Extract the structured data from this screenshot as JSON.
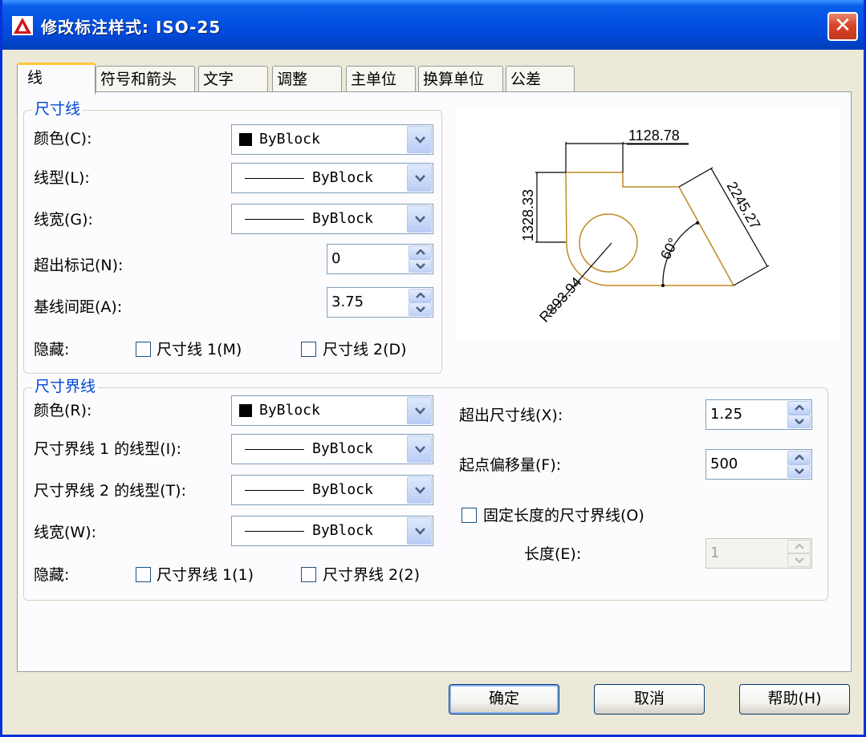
{
  "window": {
    "title": "修改标注样式: ISO-25",
    "close_label": "✕"
  },
  "tabs": [
    {
      "label": "线",
      "active": true
    },
    {
      "label": "符号和箭头"
    },
    {
      "label": "文字"
    },
    {
      "label": "调整"
    },
    {
      "label": "主单位"
    },
    {
      "label": "换算单位"
    },
    {
      "label": "公差"
    }
  ],
  "dim_lines": {
    "legend": "尺寸线",
    "color_label": "颜色(C):",
    "color_value": "ByBlock",
    "linetype_label": "线型(L):",
    "linetype_value": "ByBlock",
    "lineweight_label": "线宽(G):",
    "lineweight_value": "ByBlock",
    "extend_ticks_label": "超出标记(N):",
    "extend_ticks_value": "0",
    "baseline_spacing_label": "基线间距(A):",
    "baseline_spacing_value": "3.75",
    "suppress_label": "隐藏:",
    "suppress_1_label": "尺寸线 1(M)",
    "suppress_2_label": "尺寸线 2(D)"
  },
  "ext_lines": {
    "legend": "尺寸界线",
    "color_label": "颜色(R):",
    "color_value": "ByBlock",
    "linetype1_label": "尺寸界线 1 的线型(I):",
    "linetype1_value": "ByBlock",
    "linetype2_label": "尺寸界线 2 的线型(T):",
    "linetype2_value": "ByBlock",
    "lineweight_label": "线宽(W):",
    "lineweight_value": "ByBlock",
    "suppress_label": "隐藏:",
    "suppress_1_label": "尺寸界线 1(1)",
    "suppress_2_label": "尺寸界线 2(2)",
    "extend_beyond_label": "超出尺寸线(X):",
    "extend_beyond_value": "1.25",
    "offset_label": "起点偏移量(F):",
    "offset_value": "500",
    "fixed_length_label": "固定长度的尺寸界线(O)",
    "length_label": "长度(E):",
    "length_value": "1"
  },
  "preview": {
    "dim_top": "1128.78",
    "dim_left": "1328.33",
    "dim_right": "2245.27",
    "dim_angle": "60°",
    "dim_radius": "R893.94",
    "accent": "#c08a22"
  },
  "buttons": {
    "ok": "确定",
    "cancel": "取消",
    "help": "帮助(H)"
  },
  "colors": {
    "title_bar": "#0453e3",
    "legend_text": "#0046d5",
    "active_tab_accent": "#ffc83c"
  }
}
